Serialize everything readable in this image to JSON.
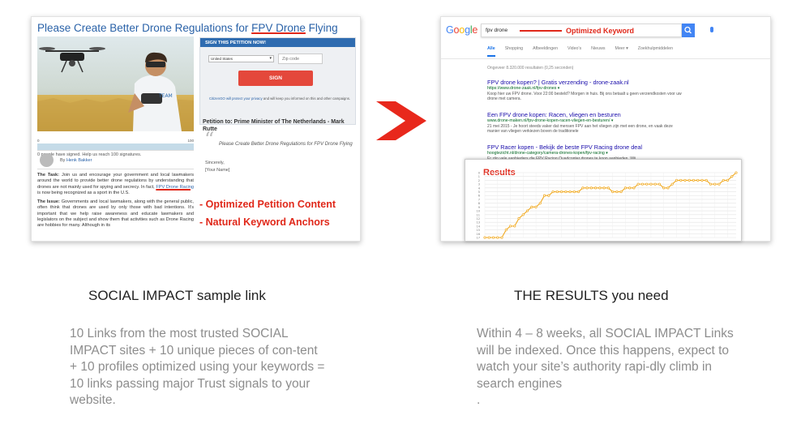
{
  "left_panel": {
    "petition_title": "Please Create Better Drone Regulations for ",
    "petition_title_keyword": "FPV Drone",
    "petition_title_end": " Flying",
    "progress_scale_start": "0",
    "progress_scale_end": "100",
    "signed_text": "0 people have signed. Help us reach 100 signatures.",
    "author_prefix": "By ",
    "author_name": "Henk Bakker",
    "task_heading": "The Task:",
    "task_text_1": " Join us and encourage your government and local lawmakers around the world to provide better drone regulations by understanding that drones are not mainly used for spying and secrecy. In fact, ",
    "task_keyword": "FPV Drone Racing",
    "task_text_2": " is now being recognized as a sport in the U.S.",
    "issue_heading": "The Issue:",
    "issue_text": " Governments and local lawmakers, along with the general public, often think that drones are used by only those with bad intentions. It's important that we help raise awareness and educate lawmakers and legislators on the subject and show them that activities such as Drone Racing are hobbies for many. Although in its",
    "form_header": "SIGN THIS PETITION NOW!",
    "country_select": "United States",
    "zip_placeholder": "Zip code",
    "sign_button": "SIGN",
    "privacy_link": "CitizenGO will protect your privacy",
    "privacy_text": " and will keep you informed on this and other campaigns.",
    "petition_to": "Petition to: Prime Minister of The Netherlands - Mark Rutte",
    "quote": "Please Create Better Drone Regulations for FPV Drone Flying",
    "sincerely": "Sincerely,",
    "your_name": "[Your Name]",
    "annotation_1": "- Optimized Petition Content",
    "annotation_2": "- Natural Keyword Anchors"
  },
  "right_panel": {
    "logo": [
      "G",
      "o",
      "o",
      "g",
      "l",
      "e"
    ],
    "logo_colors": [
      "#4285f4",
      "#ea4335",
      "#fbbc05",
      "#4285f4",
      "#34a853",
      "#ea4335"
    ],
    "search_query": "fpv drone",
    "keyword_annotation": "Optimized Keyword",
    "tabs": [
      "Alle",
      "Shopping",
      "Afbeeldingen",
      "Video's",
      "Nieuws",
      "Meer ▾",
      "Zoekhulpmiddelen"
    ],
    "result_count": "Ongeveer 8.320.000 resultaten (0,25 seconden)",
    "results": [
      {
        "title": "FPV drone kopen? | Gratis verzending - drone-zaak.nl",
        "url": "https://www.drone-zaak.nl/fpv-drones ▾",
        "snippet": "Koop hier uw FPV drone. Voor 22:00 besteld? Morgen in huis. Bij ons betaalt u geen verzendkosten voor uw drone met camera."
      },
      {
        "title": "Een FPV drone kopen: Racen, vliegen en besturen",
        "url": "www.drone-maken.nl/fpv-drone-kopen-racen-vliegen-en-besturen/ ▾",
        "snippet": "21 mei 2015 - Je hoort steeds vaker dat mensen FPV aan het vliegen zijn met een drone, en vaak deze manier van vliegen verkiezen boven de traditionele"
      },
      {
        "title": "FPV Racer kopen - Bekijk de beste FPV Racing drone deal",
        "url": "hoogtezicht.nl/drone-category/camera-drones-kopen/fpv-racing ▾",
        "snippet": "Er zijn vele aanbieders die FPV Racing Quadcopter drones te koop aanbieden. Wij"
      }
    ],
    "chart_title": "Results"
  },
  "chart_data": {
    "type": "line",
    "title": "Results",
    "x": [
      1,
      2,
      3,
      4,
      5,
      6,
      7,
      8,
      9,
      10,
      11,
      12,
      13,
      14,
      15,
      16,
      17,
      18,
      19,
      20,
      21,
      22,
      23,
      24,
      25,
      26,
      27,
      28,
      29,
      30,
      31,
      32,
      33,
      34,
      35,
      36,
      37,
      38,
      39,
      40,
      41,
      42,
      43,
      44,
      45,
      46,
      47,
      48,
      49,
      50,
      51,
      52,
      53,
      54,
      55,
      56,
      57,
      58,
      59,
      60
    ],
    "values": [
      17,
      17,
      17,
      17,
      17,
      15,
      14,
      14,
      12,
      11,
      10,
      9,
      9,
      8,
      6,
      6,
      5,
      5,
      5,
      5,
      5,
      5,
      5,
      4,
      4,
      4,
      4,
      4,
      4,
      4,
      5,
      5,
      5,
      4,
      4,
      4,
      3,
      3,
      3,
      3,
      3,
      3,
      4,
      4,
      3,
      2,
      2,
      2,
      2,
      2,
      2,
      2,
      2,
      3,
      3,
      3,
      2,
      2,
      1,
      0
    ],
    "ylim": [
      0,
      17
    ],
    "y_inverted": true,
    "ytick_labels": [
      "0",
      "1",
      "2",
      "3",
      "4",
      "5",
      "6",
      "7",
      "8",
      "9",
      "10",
      "11",
      "12",
      "13",
      "14",
      "15",
      "16",
      "17"
    ],
    "line_color": "#f0a81e",
    "grid": true
  },
  "captions": {
    "left_title": "SOCIAL IMPACT sample link",
    "left_desc": "10 Links from the most trusted SOCIAL IMPACT sites + 10 unique pieces of con-tent + 10 profiles optimized using your keywords = 10 links passing major Trust signals to your website.",
    "right_title": "THE RESULTS you need",
    "right_desc": "Within 4 – 8 weeks, all SOCIAL IMPACT Links will be indexed. Once this happens, expect to watch your site’s authority rapi-dly climb in search engines",
    "right_desc_end": "."
  },
  "colors": {
    "accent_red": "#e0281a",
    "link_blue": "#2a62a8",
    "arrow_red": "#e8281c"
  }
}
